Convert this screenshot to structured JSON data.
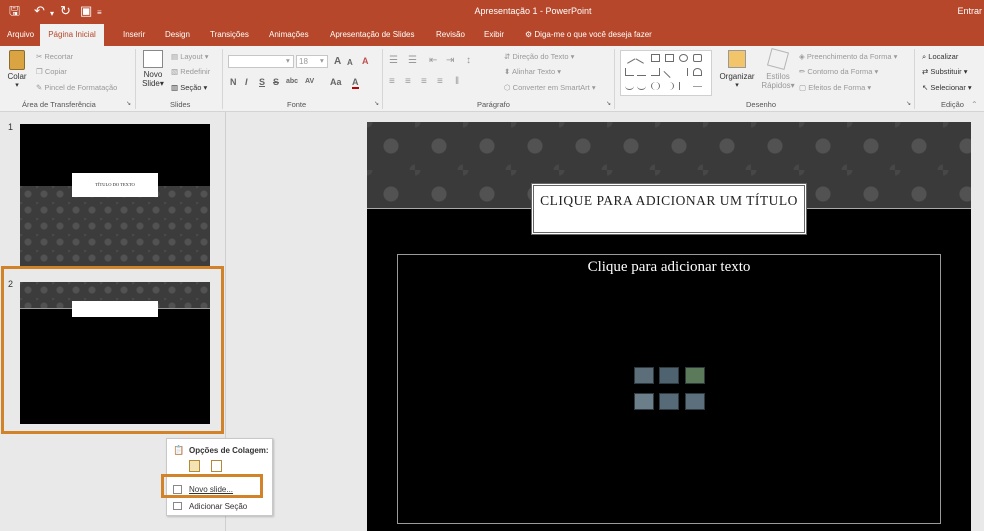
{
  "window": {
    "title": "Apresentação 1 - PowerPoint",
    "signin": "Entrar"
  },
  "quick_access": {
    "save_icon": "save-icon",
    "undo_icon": "undo-icon",
    "redo_icon": "redo-icon",
    "present_icon": "present-icon"
  },
  "tabs": [
    {
      "label": "Arquivo"
    },
    {
      "label": "Página Inicial",
      "active": true
    },
    {
      "label": "Inserir"
    },
    {
      "label": "Design"
    },
    {
      "label": "Transições"
    },
    {
      "label": "Animações"
    },
    {
      "label": "Apresentação de Slides"
    },
    {
      "label": "Revisão"
    },
    {
      "label": "Exibir"
    },
    {
      "label": "Diga-me o que você deseja fazer"
    }
  ],
  "ribbon": {
    "clipboard": {
      "paste": "Colar",
      "cut": "Recortar",
      "copy": "Copiar",
      "format_painter": "Pincel de Formatação",
      "label": "Área de Transferência"
    },
    "slides": {
      "new_slide_line1": "Novo",
      "new_slide_line2": "Slide",
      "layout": "Layout",
      "reset": "Redefinir",
      "section": "Seção",
      "label": "Slides"
    },
    "font": {
      "size": "18",
      "label": "Fonte",
      "bold": "N",
      "italic": "I",
      "underline": "S",
      "strike": "S",
      "shadow": "abc",
      "spacing": "AV",
      "case": "Aa",
      "grow": "A",
      "shrink": "A",
      "clear": "A",
      "color": "A"
    },
    "paragraph": {
      "text_direction": "Direção do Texto",
      "align_text": "Alinhar Texto",
      "smartart": "Converter em SmartArt",
      "label": "Parágrafo"
    },
    "drawing": {
      "arrange": "Organizar",
      "quick_styles_line1": "Estilos",
      "quick_styles_line2": "Rápidos",
      "shape_fill": "Preenchimento da Forma",
      "shape_outline": "Contorno da Forma",
      "shape_effects": "Efeitos de Forma",
      "label": "Desenho"
    },
    "editing": {
      "find": "Localizar",
      "replace": "Substituir",
      "select": "Selecionar",
      "label": "Edição"
    }
  },
  "slides_pane": {
    "slides": [
      {
        "number": "1",
        "title": "TÍTULO DO TEXTO"
      },
      {
        "number": "2",
        "title": ""
      }
    ]
  },
  "slide": {
    "title": "CLIQUE PARA ADICIONAR UM TÍTULO",
    "content": "Clique para adicionar texto"
  },
  "context_menu": {
    "header": "Opções de Colagem:",
    "items": [
      {
        "label": "Novo slide..."
      },
      {
        "label": "Adicionar Seção"
      }
    ]
  },
  "colors": {
    "accent": "#b7472a",
    "highlight": "#d2832a"
  }
}
